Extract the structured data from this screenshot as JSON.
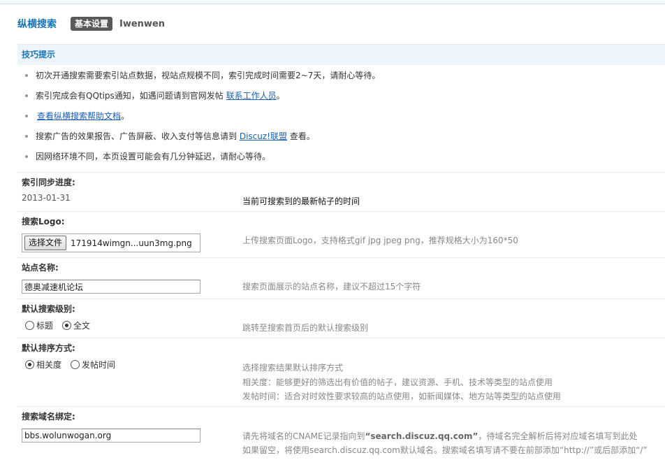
{
  "header": {
    "app_title": "纵横搜索",
    "tab_active": "基本设置",
    "tab_user": "Iwenwen"
  },
  "tips": {
    "title": "技巧提示",
    "items": [
      {
        "text": "初次开通搜索需要索引站点数据，视站点规模不同，索引完成时间需要2~7天，请耐心等待。"
      },
      {
        "text": "索引完成会有QQtips通知，如遇问题请到官网发帖 ",
        "link": "联系工作人员",
        "after": "。"
      },
      {
        "text": "",
        "link": "查看纵横搜索帮助文档",
        "after": "。"
      },
      {
        "text": "搜索广告的效果报告、广告屏蔽、收入支付等信息请到 ",
        "link": "Discuz!联盟",
        "after": " 查看。"
      },
      {
        "text": "因网络环境不同，本页设置可能会有几分钟延迟，请耐心等待。"
      }
    ]
  },
  "index_progress": {
    "label": "索引同步进度:",
    "value": "2013-01-31",
    "desc": "当前可搜索到的最新帖子的时间"
  },
  "logo": {
    "label": "搜索Logo:",
    "button": "选择文件",
    "file_name": "171914wimgn...uun3mg.png",
    "desc": "上传搜索页面Logo，支持格式gif jpg jpeg png，推荐规格大小为160*50"
  },
  "site_name": {
    "label": "站点名称:",
    "value": "德奥减速机论坛",
    "desc": "搜索页面展示的站点名称，建议不超过15个字符"
  },
  "default_level": {
    "label": "默认搜索级别:",
    "options": [
      "标题",
      "全文"
    ],
    "selected": "全文",
    "desc": "跳转至搜索首页后的默认搜索级别"
  },
  "default_sort": {
    "label": "默认排序方式:",
    "options": [
      "相关度",
      "发帖时间"
    ],
    "selected": "相关度",
    "desc_1": "选择搜索结果默认排序方式",
    "desc_2": "相关度：能够更好的筛选出有价值的帖子，建议资源、手机、技术等类型的站点使用",
    "desc_3": "发帖时间：适合对时效性要求较高的站点使用，如新闻媒体、地方站等类型的站点使用"
  },
  "domain": {
    "label": "搜索域名绑定:",
    "value": "bbs.wolunwogan.org",
    "desc_1_pre": "请先将域名的CNAME记录指向到",
    "desc_1_bold": "“search.discuz.qq.com”",
    "desc_1_post": "，待域名完全解析后将对应域名填写到此处",
    "desc_2": "如果留空，将使用search.discuz.qq.com默认域名。搜索域名填写请不要在前部添加“http://”或后部添加“/”"
  }
}
